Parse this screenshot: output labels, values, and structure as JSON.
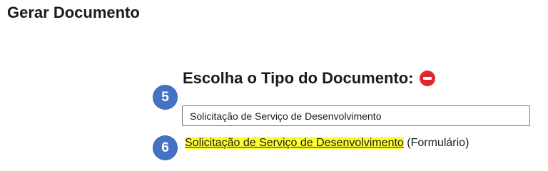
{
  "page": {
    "title": "Gerar Documento"
  },
  "document_type": {
    "heading": "Escolha o Tipo do Documento:",
    "remove_icon": "minus-circle-icon",
    "input_value": "Solicitação de Serviço de Desenvolvimento",
    "result_link": "Solicitação de Serviço de Desenvolvimento",
    "result_suffix": " (Formulário)"
  },
  "steps": {
    "step_a": "5",
    "step_b": "6"
  },
  "colors": {
    "badge": "#4472c4",
    "remove_icon": "#e0262f",
    "highlight": "#ffff33"
  }
}
